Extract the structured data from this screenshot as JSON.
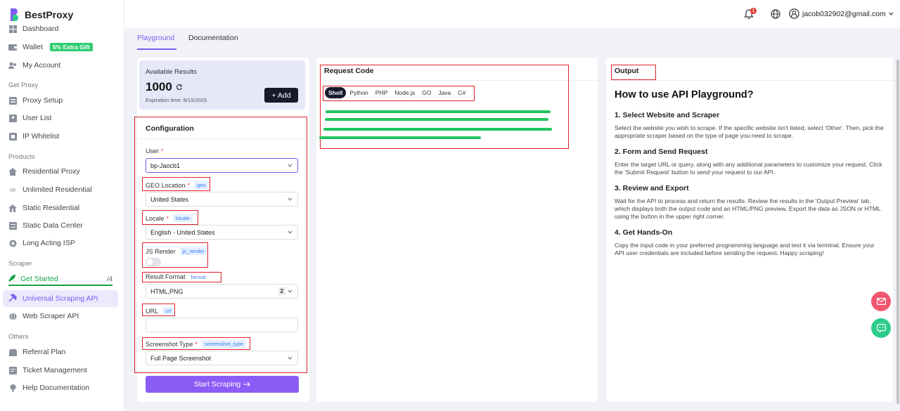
{
  "brand": {
    "name": "BestProxy"
  },
  "sidebar": {
    "dashboard": "Dashboard",
    "wallet": "Wallet",
    "wallet_badge": "5% Extra Gift",
    "account": "My Account",
    "sec_get_proxy": "Get Proxy",
    "proxy_setup": "Proxy Setup",
    "user_list": "User List",
    "ip_whitelist": "IP Whitelist",
    "sec_products": "Products",
    "residential": "Residential Proxy",
    "unlimited": "Unlimited Residential",
    "static_res": "Static Residential",
    "static_dc": "Static Data Center",
    "long_isp": "Long Acting ISP",
    "sec_scraper": "Scraper",
    "get_started": "Get Started",
    "get_started_count": "/4",
    "universal_api": "Universal Scraping API",
    "web_scraper_api": "Web Scraper API",
    "sec_others": "Others",
    "referral": "Referral Plan",
    "ticket": "Ticket Management",
    "help": "Help Documentation"
  },
  "topbar": {
    "notification_count": "1",
    "user_email": "jacob032902@gmail.com"
  },
  "tabs": {
    "playground": "Playground",
    "documentation": "Documentation"
  },
  "results": {
    "label": "Available Results",
    "value": "1000",
    "expiration": "Expiration time: 8/15/2025",
    "add_label": "+ Add"
  },
  "config": {
    "title": "Configuration",
    "user_label": "User",
    "user_value": "bp-Jaocb1",
    "geo_label": "GEO Location",
    "geo_tag": "geo",
    "geo_value": "United States",
    "locale_label": "Locale",
    "locale_tag": "locale",
    "locale_value": "English - United States",
    "js_label": "JS Render",
    "js_tag": "js_render",
    "js_enabled": false,
    "format_label": "Result Format",
    "format_tag": "format",
    "format_value": "HTML,PNG",
    "format_count": "2",
    "url_label": "URL",
    "url_tag": "url",
    "url_value": "",
    "shot_label": "Screenshot Type",
    "shot_tag": "screenshot_type",
    "shot_value": "Full Page Screenshot",
    "start_label": "Start Scraping"
  },
  "request": {
    "title": "Request Code",
    "languages": [
      "Shell",
      "Python",
      "PHP",
      "Node.js",
      "GO",
      "Java",
      "C#"
    ],
    "active_language": "Shell"
  },
  "output": {
    "title": "Output",
    "heading": "How to use API Playground?",
    "steps": [
      {
        "title": "1. Select Website and Scraper",
        "text": "Select the website you wish to scrape. If the specific website isn't listed, select 'Other'. Then, pick the appropriate scraper based on the type of page you need to scrape."
      },
      {
        "title": "2. Form and Send Request",
        "text": "Enter the target URL or query, along with any additional parameters to customize your request. Click the 'Submit Request' button to send your request to our API."
      },
      {
        "title": "3. Review and Export",
        "text": "Wait for the API to process and return the results. Review the results in the 'Output Preview' tab, which displays both the output code and an HTML/PNG preview. Export the data as JSON or HTML using the button in the upper right corner."
      },
      {
        "title": "4. Get Hands-On",
        "text": "Copy the input code in your preferred programming language and test it via terminal. Ensure your API user credentials are included before sending the request. Happy scraping!"
      }
    ]
  },
  "colors": {
    "accent": "#7c5cf0",
    "success": "#16a34a",
    "annotation": "#e0202a"
  }
}
